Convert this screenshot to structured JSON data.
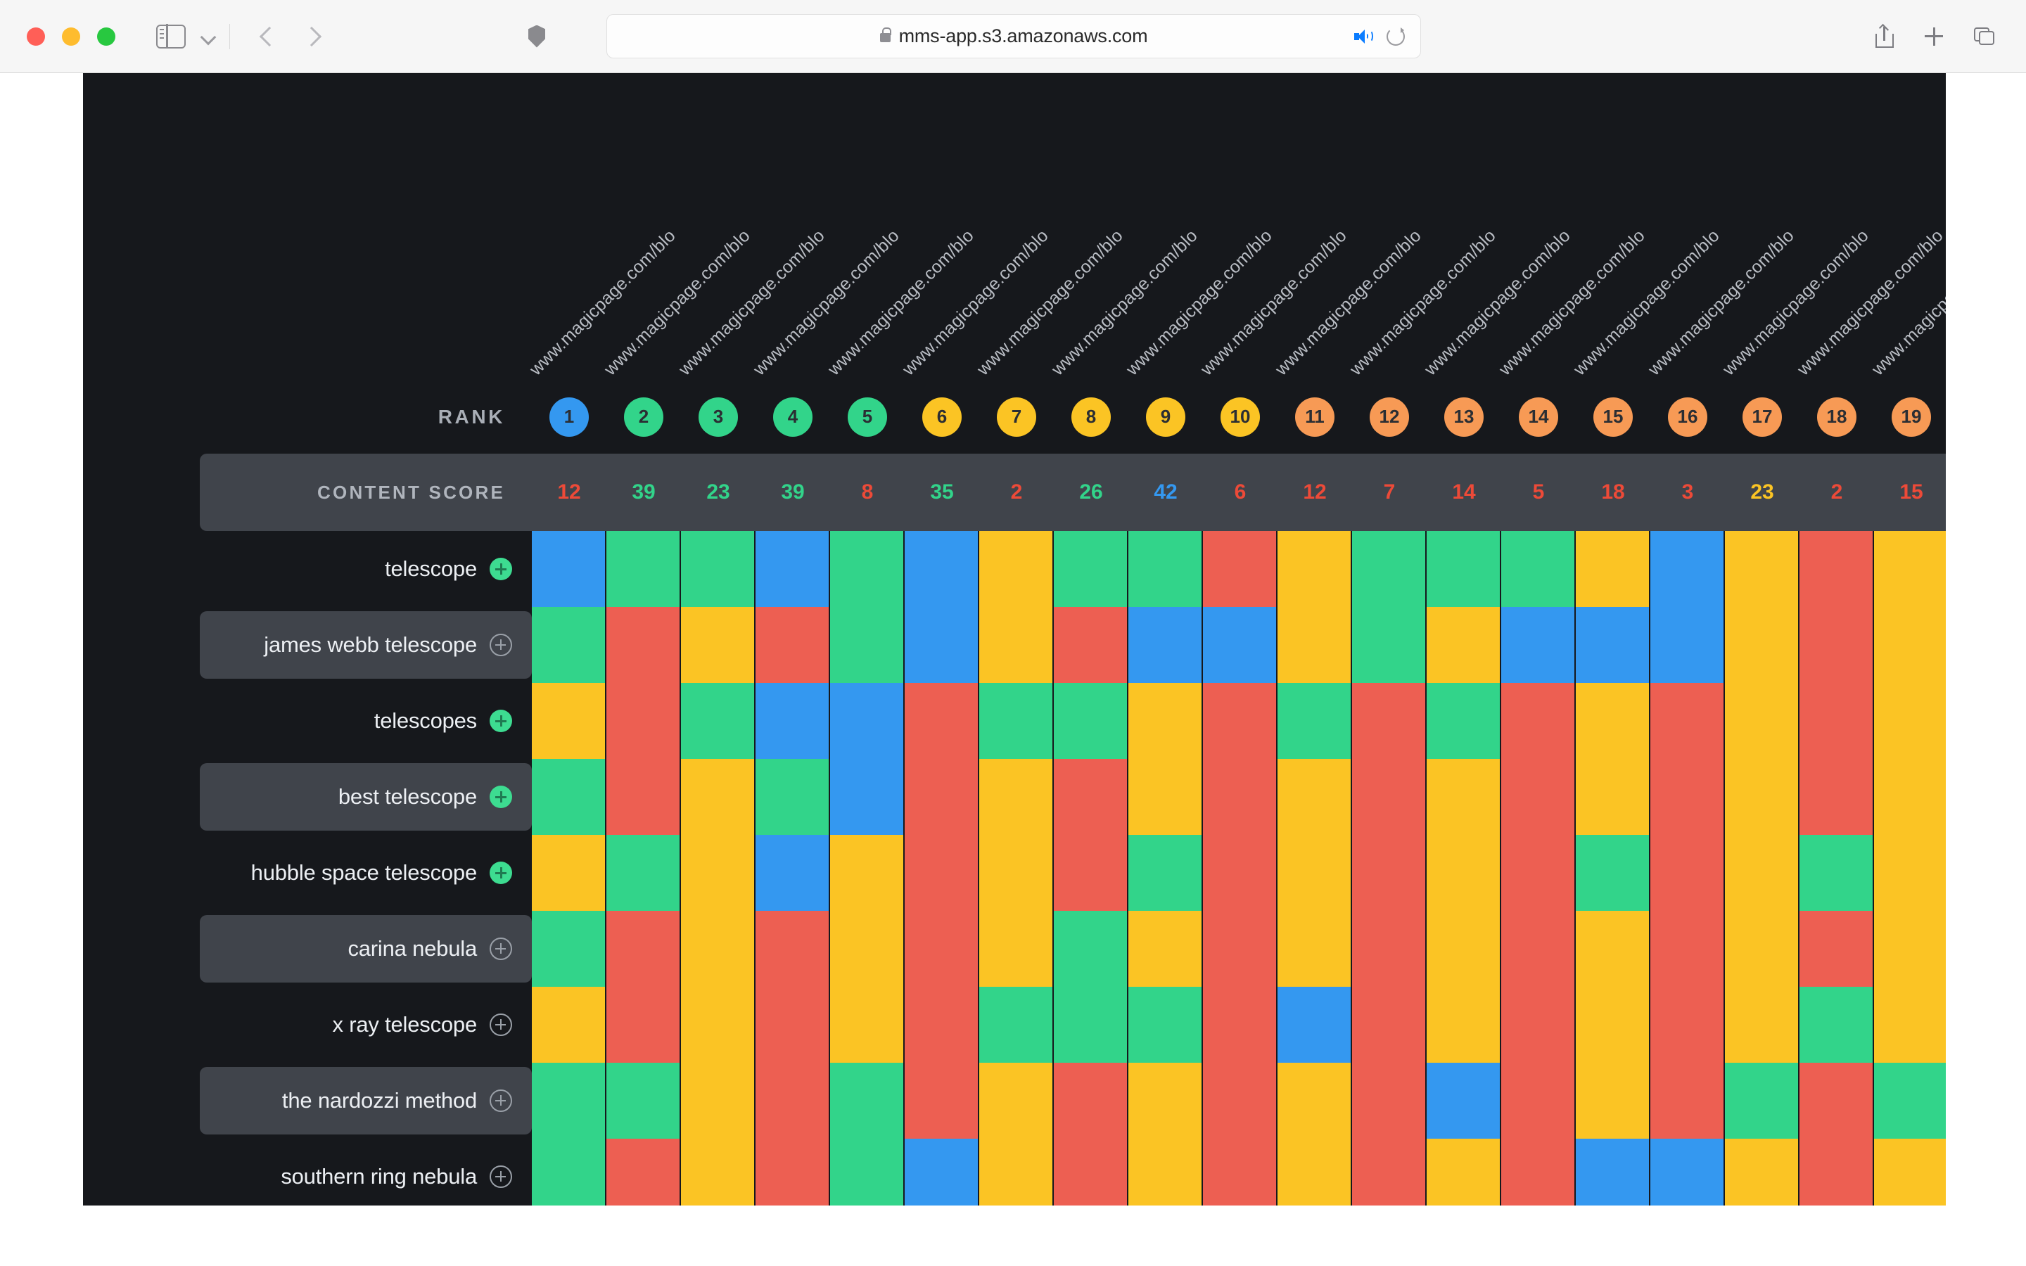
{
  "browser": {
    "url": "mms-app.s3.amazonaws.com",
    "icons": {
      "sidebar": "sidebar-toggle-icon",
      "chevron": "chevron-down-icon",
      "back": "back-arrow-icon",
      "forward": "forward-arrow-icon",
      "shield": "shield-icon",
      "lock": "lock-icon",
      "speaker": "speaker-icon",
      "reload": "reload-icon",
      "share": "share-icon",
      "new_tab": "plus-icon",
      "tabs": "tabs-overview-icon"
    }
  },
  "table": {
    "rank_label": "RANK",
    "content_score_label": "CONTENT SCORE",
    "column_urls": [
      "www.magicpage.com/blo",
      "www.magicpage.com/blo",
      "www.magicpage.com/blo",
      "www.magicpage.com/blo",
      "www.magicpage.com/blo",
      "www.magicpage.com/blo",
      "www.magicpage.com/blo",
      "www.magicpage.com/blo",
      "www.magicpage.com/blo",
      "www.magicpage.com/blo",
      "www.magicpage.com/blo",
      "www.magicpage.com/blo",
      "www.magicpage.com/blo",
      "www.magicpage.com/blo",
      "www.magicpage.com/blo",
      "www.magicpage.com/blo",
      "www.magicpage.com/blo",
      "www.magicpage.com/blo",
      "www.magicpag"
    ],
    "ranks": [
      {
        "n": "1",
        "color": "#3498f0"
      },
      {
        "n": "2",
        "color": "#32d48a"
      },
      {
        "n": "3",
        "color": "#32d48a"
      },
      {
        "n": "4",
        "color": "#32d48a"
      },
      {
        "n": "5",
        "color": "#32d48a"
      },
      {
        "n": "6",
        "color": "#fbc424"
      },
      {
        "n": "7",
        "color": "#fbc424"
      },
      {
        "n": "8",
        "color": "#fbc424"
      },
      {
        "n": "9",
        "color": "#fbc424"
      },
      {
        "n": "10",
        "color": "#fbc424"
      },
      {
        "n": "11",
        "color": "#f79a55"
      },
      {
        "n": "12",
        "color": "#f79a55"
      },
      {
        "n": "13",
        "color": "#f79a55"
      },
      {
        "n": "14",
        "color": "#f79a55"
      },
      {
        "n": "15",
        "color": "#f79a55"
      },
      {
        "n": "16",
        "color": "#f79a55"
      },
      {
        "n": "17",
        "color": "#f79a55"
      },
      {
        "n": "18",
        "color": "#f79a55"
      },
      {
        "n": "19",
        "color": "#f79a55"
      }
    ],
    "content_scores": [
      {
        "v": "12",
        "color": "#ed4a38"
      },
      {
        "v": "39",
        "color": "#32d48a"
      },
      {
        "v": "23",
        "color": "#32d48a"
      },
      {
        "v": "39",
        "color": "#32d48a"
      },
      {
        "v": "8",
        "color": "#ed4a38"
      },
      {
        "v": "35",
        "color": "#32d48a"
      },
      {
        "v": "2",
        "color": "#ed4a38"
      },
      {
        "v": "26",
        "color": "#32d48a"
      },
      {
        "v": "42",
        "color": "#3498f0"
      },
      {
        "v": "6",
        "color": "#ed4a38"
      },
      {
        "v": "12",
        "color": "#ed4a38"
      },
      {
        "v": "7",
        "color": "#ed4a38"
      },
      {
        "v": "14",
        "color": "#ed4a38"
      },
      {
        "v": "5",
        "color": "#ed4a38"
      },
      {
        "v": "18",
        "color": "#ed4a38"
      },
      {
        "v": "3",
        "color": "#ed4a38"
      },
      {
        "v": "23",
        "color": "#fbc424"
      },
      {
        "v": "2",
        "color": "#ed4a38"
      },
      {
        "v": "15",
        "color": "#ed4a38"
      }
    ],
    "rows": [
      {
        "keyword": "telescope",
        "plus": "filled",
        "cells": [
          "blue",
          "green",
          "green",
          "blue",
          "green",
          "blue",
          "yellow",
          "green",
          "green",
          "red",
          "yellow",
          "green",
          "green",
          "green",
          "yellow",
          "blue",
          "yellow",
          "red",
          "yellow"
        ]
      },
      {
        "keyword": "james webb telescope",
        "plus": "hollow",
        "cells": [
          "green",
          "red",
          "yellow",
          "red",
          "green",
          "blue",
          "yellow",
          "red",
          "blue",
          "blue",
          "yellow",
          "green",
          "yellow",
          "blue",
          "blue",
          "blue",
          "yellow",
          "red",
          "yellow"
        ]
      },
      {
        "keyword": "telescopes",
        "plus": "filled",
        "cells": [
          "yellow",
          "red",
          "green",
          "blue",
          "blue",
          "red",
          "green",
          "green",
          "yellow",
          "red",
          "green",
          "red",
          "green",
          "red",
          "yellow",
          "red",
          "yellow",
          "red",
          "yellow"
        ]
      },
      {
        "keyword": "best telescope",
        "plus": "filled",
        "cells": [
          "green",
          "red",
          "yellow",
          "green",
          "blue",
          "red",
          "yellow",
          "red",
          "yellow",
          "red",
          "yellow",
          "red",
          "yellow",
          "red",
          "yellow",
          "red",
          "yellow",
          "red",
          "yellow"
        ]
      },
      {
        "keyword": "hubble space telescope",
        "plus": "filled",
        "cells": [
          "yellow",
          "green",
          "yellow",
          "blue",
          "yellow",
          "red",
          "yellow",
          "red",
          "green",
          "red",
          "yellow",
          "red",
          "yellow",
          "red",
          "green",
          "red",
          "yellow",
          "green",
          "yellow"
        ]
      },
      {
        "keyword": "carina nebula",
        "plus": "hollow",
        "cells": [
          "green",
          "red",
          "yellow",
          "red",
          "yellow",
          "red",
          "yellow",
          "green",
          "yellow",
          "red",
          "yellow",
          "red",
          "yellow",
          "red",
          "yellow",
          "red",
          "yellow",
          "red",
          "yellow"
        ]
      },
      {
        "keyword": "x ray telescope",
        "plus": "hollow",
        "cells": [
          "yellow",
          "red",
          "yellow",
          "red",
          "yellow",
          "red",
          "green",
          "green",
          "green",
          "red",
          "blue",
          "red",
          "yellow",
          "red",
          "yellow",
          "red",
          "yellow",
          "green",
          "yellow"
        ]
      },
      {
        "keyword": "the nardozzi method",
        "plus": "hollow",
        "cells": [
          "green",
          "green",
          "yellow",
          "red",
          "green",
          "red",
          "yellow",
          "red",
          "yellow",
          "red",
          "yellow",
          "red",
          "blue",
          "red",
          "yellow",
          "red",
          "green",
          "red",
          "green"
        ]
      },
      {
        "keyword": "southern ring nebula",
        "plus": "hollow",
        "cells": [
          "green",
          "red",
          "yellow",
          "red",
          "green",
          "blue",
          "yellow",
          "red",
          "yellow",
          "red",
          "yellow",
          "red",
          "yellow",
          "red",
          "blue",
          "blue",
          "yellow",
          "red",
          "yellow"
        ]
      }
    ]
  }
}
